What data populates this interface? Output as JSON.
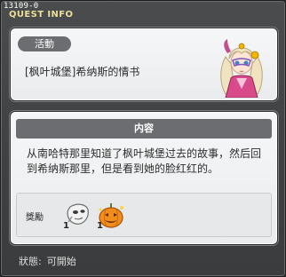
{
  "window": {
    "quest_id": "13109-0",
    "title": "QUEST INFO"
  },
  "quest": {
    "category": "活動",
    "name": "[枫叶城堡]希纳斯的情书"
  },
  "content": {
    "header": "内容",
    "description": "从南哈特那里知道了枫叶城堡过去的故事，然后回到希纳斯那里，但是看到她的脸红红的。"
  },
  "rewards": {
    "label": "獎勵",
    "items": [
      {
        "icon": "mask-item-icon",
        "count": "1"
      },
      {
        "icon": "pumpkin-lantern-item-icon",
        "count": "1"
      }
    ]
  },
  "status": {
    "label": "狀態:",
    "value": "可開始"
  },
  "colors": {
    "title": "#eadf9a",
    "panel_bg": "#f1f2f3",
    "pill_bg": "#6b6d70",
    "window_bg": "#3e4041"
  }
}
